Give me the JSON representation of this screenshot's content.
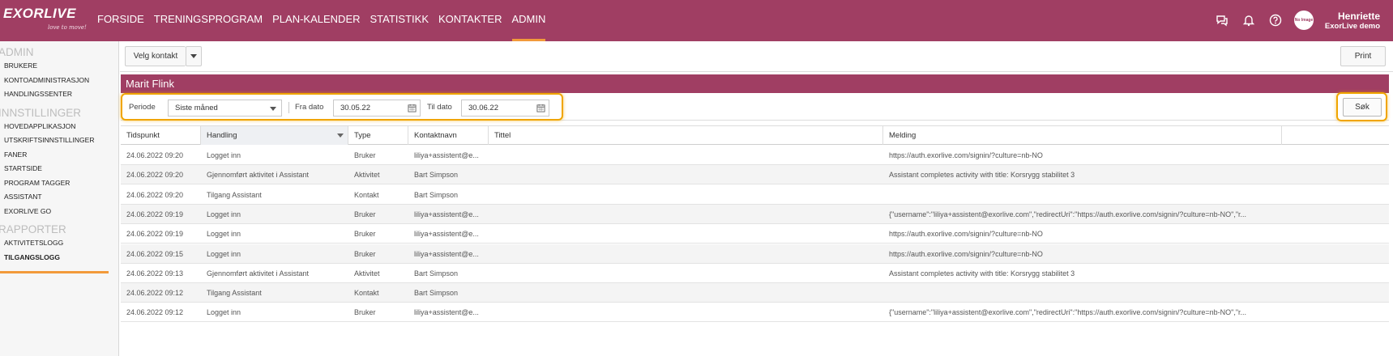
{
  "brand": {
    "logo_text": "EXORLIVE",
    "tagline": "love to move!"
  },
  "nav": {
    "items": [
      {
        "label": "FORSIDE"
      },
      {
        "label": "TRENINGSPROGRAM"
      },
      {
        "label": "PLAN-KALENDER"
      },
      {
        "label": "STATISTIKK"
      },
      {
        "label": "KONTAKTER"
      },
      {
        "label": "ADMIN",
        "active": true
      }
    ]
  },
  "header_icons": [
    "chat-icon",
    "bell-icon",
    "help-icon",
    "avatar"
  ],
  "user": {
    "name": "Henriette",
    "account": "ExorLive demo",
    "avatar_text": "No Image"
  },
  "sidebar": {
    "sections": [
      {
        "title": "ADMIN",
        "items": [
          "BRUKERE",
          "KONTOADMINISTRASJON",
          "HANDLINGSSENTER"
        ]
      },
      {
        "title": "INNSTILLINGER",
        "items": [
          "HOVEDAPPLIKASJON",
          "UTSKRIFTSINNSTILLINGER",
          "FANER",
          "STARTSIDE",
          "PROGRAM TAGGER",
          "ASSISTANT",
          "EXORLIVE GO"
        ]
      },
      {
        "title": "RAPPORTER",
        "items": [
          "AKTIVITETSLOGG",
          "TILGANGSLOGG"
        ]
      }
    ],
    "active_item": "TILGANGSLOGG"
  },
  "toolbar": {
    "contact_button": "Velg kontakt",
    "print_button": "Print"
  },
  "panel": {
    "title": "Marit Flink"
  },
  "filters": {
    "period_label": "Periode",
    "period_value": "Siste måned",
    "from_label": "Fra dato",
    "from_value": "30.05.22",
    "to_label": "Til dato",
    "to_value": "30.06.22",
    "search_button": "Søk"
  },
  "table": {
    "columns": [
      "Tidspunkt",
      "Handling",
      "Type",
      "Kontaktnavn",
      "Tittel",
      "Melding"
    ],
    "rows": [
      [
        "24.06.2022 09:20",
        "Logget inn",
        "Bruker",
        "liliya+assistent@e...",
        "",
        "https://auth.exorlive.com/signin/?culture=nb-NO"
      ],
      [
        "24.06.2022 09:20",
        "Gjennomført aktivitet i Assistant",
        "Aktivitet",
        "Bart Simpson",
        "",
        "Assistant completes activity with title: Korsrygg stabilitet 3"
      ],
      [
        "24.06.2022 09:20",
        "Tilgang Assistant",
        "Kontakt",
        "Bart Simpson",
        "",
        ""
      ],
      [
        "24.06.2022 09:19",
        "Logget inn",
        "Bruker",
        "liliya+assistent@e...",
        "",
        "{\"username\":\"liliya+assistent@exorlive.com\",\"redirectUri\":\"https://auth.exorlive.com/signin/?culture=nb-NO\",\"r..."
      ],
      [
        "24.06.2022 09:19",
        "Logget inn",
        "Bruker",
        "liliya+assistent@e...",
        "",
        "https://auth.exorlive.com/signin/?culture=nb-NO"
      ],
      [
        "24.06.2022 09:15",
        "Logget inn",
        "Bruker",
        "liliya+assistent@e...",
        "",
        "https://auth.exorlive.com/signin/?culture=nb-NO"
      ],
      [
        "24.06.2022 09:13",
        "Gjennomført aktivitet i Assistant",
        "Aktivitet",
        "Bart Simpson",
        "",
        "Assistant completes activity with title: Korsrygg stabilitet 3"
      ],
      [
        "24.06.2022 09:12",
        "Tilgang Assistant",
        "Kontakt",
        "Bart Simpson",
        "",
        ""
      ],
      [
        "24.06.2022 09:12",
        "Logget inn",
        "Bruker",
        "liliya+assistent@e...",
        "",
        "{\"username\":\"liliya+assistent@exorlive.com\",\"redirectUri\":\"https://auth.exorlive.com/signin/?culture=nb-NO\",\"r..."
      ]
    ]
  },
  "colors": {
    "brand": "#a03e63",
    "accent": "#f29a3a",
    "highlight": "#f0a500"
  }
}
